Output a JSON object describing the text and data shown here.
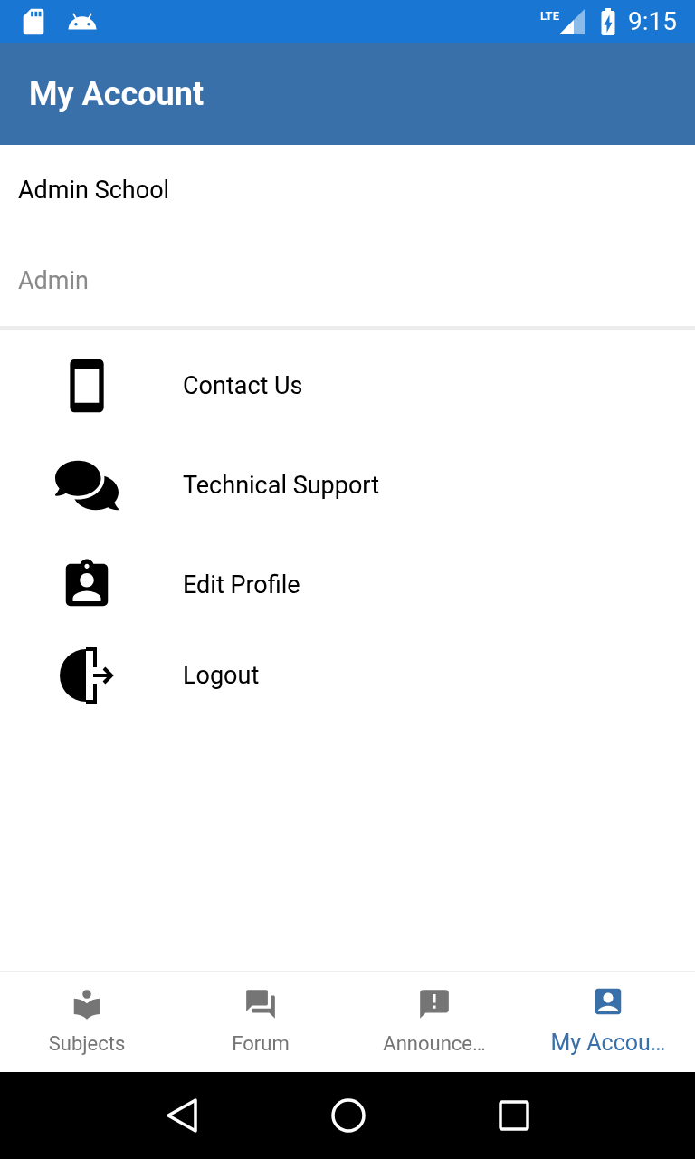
{
  "status_bar": {
    "network": "LTE",
    "time": "9:15"
  },
  "app_bar": {
    "title": "My Account"
  },
  "account": {
    "name": "Admin School",
    "role": "Admin"
  },
  "menu": [
    {
      "kind": "phone",
      "label": "Contact Us"
    },
    {
      "kind": "chat",
      "label": "Technical Support"
    },
    {
      "kind": "badge",
      "label": "Edit Profile"
    },
    {
      "kind": "logout",
      "label": "Logout"
    }
  ],
  "bottom_nav": [
    {
      "kind": "subjects",
      "label": "Subjects",
      "selected": false
    },
    {
      "kind": "forum",
      "label": "Forum",
      "selected": false
    },
    {
      "kind": "announce",
      "label": "Announce…",
      "selected": false
    },
    {
      "kind": "account",
      "label": "My Accou…",
      "selected": true
    }
  ]
}
